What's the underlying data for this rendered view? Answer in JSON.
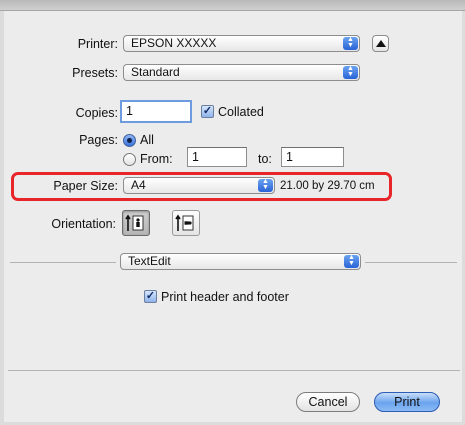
{
  "printer": {
    "label": "Printer:",
    "value": "EPSON XXXXX"
  },
  "presets": {
    "label": "Presets:",
    "value": "Standard"
  },
  "copies": {
    "label": "Copies:",
    "value": "1",
    "collated_label": "Collated",
    "collated_checked": true
  },
  "pages": {
    "label": "Pages:",
    "all_label": "All",
    "from_label": "From:",
    "from_value": "1",
    "to_label": "to:",
    "to_value": "1",
    "selected": "All"
  },
  "paper_size": {
    "label": "Paper Size:",
    "value": "A4",
    "dimensions": "21.00 by 29.70 cm",
    "highlight_color": "#e8262a"
  },
  "orientation": {
    "label": "Orientation:",
    "selected": "portrait"
  },
  "app_section": {
    "value": "TextEdit"
  },
  "print_header_footer": {
    "label": "Print header and footer",
    "checked": true
  },
  "buttons": {
    "cancel": "Cancel",
    "print": "Print"
  },
  "colors": {
    "accent_blue": "#3a72dd",
    "panel": "#ececec"
  }
}
